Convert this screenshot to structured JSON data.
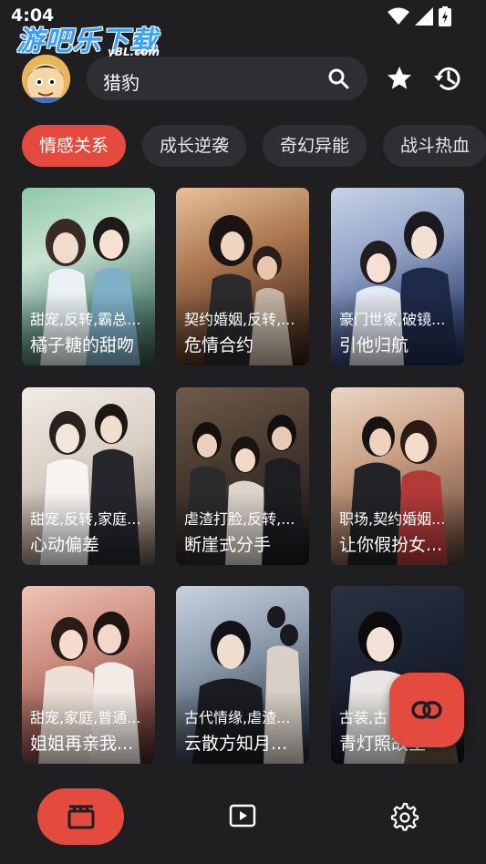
{
  "status_bar": {
    "time": "4:04"
  },
  "watermark": {
    "main": "游吧乐下载",
    "sub": "yBL.com"
  },
  "search": {
    "query": "猎豹"
  },
  "chips": [
    {
      "label": "情感关系",
      "active": true
    },
    {
      "label": "成长逆袭",
      "active": false
    },
    {
      "label": "奇幻异能",
      "active": false
    },
    {
      "label": "战斗热血",
      "active": false
    }
  ],
  "cards": [
    {
      "tags": "甜宠,反转,霸总...",
      "title": "橘子糖的甜吻"
    },
    {
      "tags": "契约婚姻,反转,...",
      "title": "危情合约"
    },
    {
      "tags": "豪门世家,破镜...",
      "title": "引他归航"
    },
    {
      "tags": "甜宠,反转,家庭...",
      "title": "心动偏差"
    },
    {
      "tags": "虐渣打脸,反转,...",
      "title": "断崖式分手"
    },
    {
      "tags": "职场,契约婚姻...",
      "title": "让你假扮女..."
    },
    {
      "tags": "甜宠,家庭,普通...",
      "title": "姐姐再亲我..."
    },
    {
      "tags": "古代情缘,虐渣...",
      "title": "云散方知月..."
    },
    {
      "tags": "古装,古...",
      "title": "青灯照故里"
    }
  ],
  "colors": {
    "accent": "#e54a3f",
    "background": "#1f1f22",
    "surface": "#2e2f33"
  },
  "icons": {
    "search": "search-icon",
    "favorite": "star-icon",
    "history": "history-icon",
    "link": "link-icon",
    "home_tab": "clapperboard-icon",
    "player_tab": "play-icon",
    "settings_tab": "gear-icon"
  }
}
